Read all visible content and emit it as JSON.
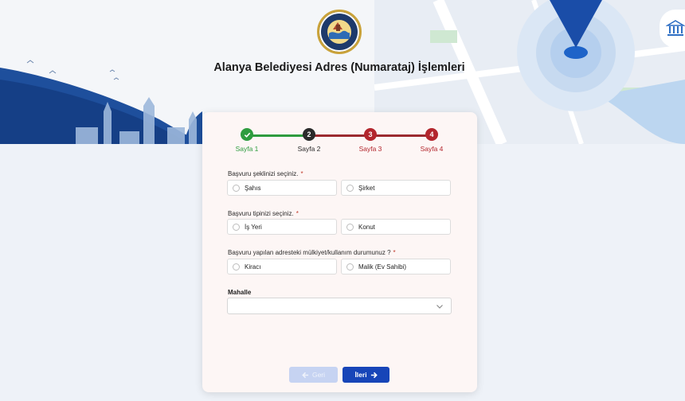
{
  "header": {
    "title": "Alanya Belediyesi Adres (Numarataj) İşlemleri",
    "logo_icon": "municipality-seal-icon",
    "corner_icon": "government-building-icon"
  },
  "stepper": {
    "steps": [
      {
        "label": "Sayfa 1",
        "number": "",
        "state": "done",
        "color": "#2e9c3f"
      },
      {
        "label": "Sayfa 2",
        "number": "2",
        "state": "current",
        "color": "#2a2a2a"
      },
      {
        "label": "Sayfa 3",
        "number": "3",
        "state": "pending",
        "color": "#b3262d"
      },
      {
        "label": "Sayfa 4",
        "number": "4",
        "state": "pending",
        "color": "#b3262d"
      }
    ]
  },
  "form": {
    "q1": {
      "label": "Başvuru şeklinizi seçiniz.",
      "required": "*",
      "options": [
        "Şahıs",
        "Şirket"
      ]
    },
    "q2": {
      "label": "Başvuru tipinizi seçiniz.",
      "required": "*",
      "options": [
        "İş Yeri",
        "Konut"
      ]
    },
    "q3": {
      "label": "Başvuru yapılan adresteki mülkiyet/kullanım durumunuz ?",
      "required": "*",
      "options": [
        "Kiracı",
        "Malik (Ev Sahibi)"
      ]
    },
    "mahalle": {
      "label": "Mahalle",
      "value": ""
    }
  },
  "buttons": {
    "back": "Geri",
    "next": "İleri"
  },
  "colors": {
    "accent": "#1745b8",
    "done": "#2e9c3f",
    "pending": "#b3262d"
  }
}
